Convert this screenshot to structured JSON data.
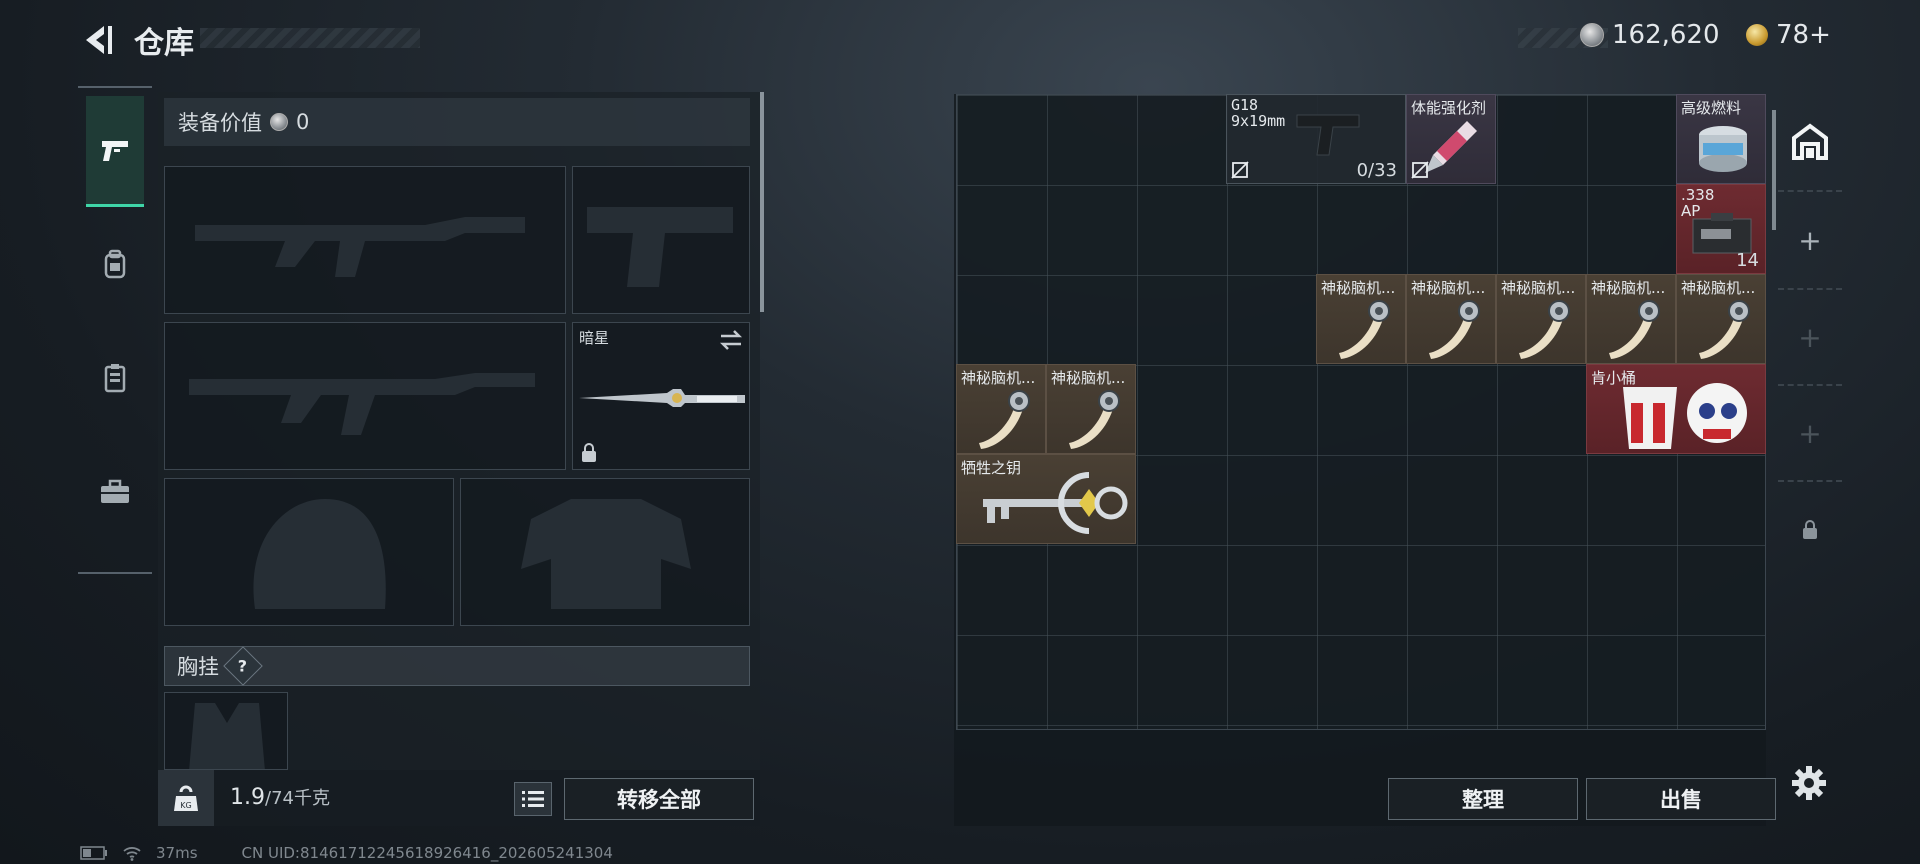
{
  "header": {
    "title": "仓库",
    "silver_amount": "162,620",
    "gold_amount": "78+"
  },
  "loadout": {
    "equip_value_label": "装备价值",
    "equip_value": "0",
    "melee_name": "暗星",
    "chest_label": "胸挂",
    "chest_help": "?"
  },
  "footer": {
    "weight_current": "1.9",
    "weight_max": "/74千克",
    "transfer_all": "转移全部",
    "sort": "整理",
    "sell": "出售",
    "ping": "37ms",
    "uid": "CN UID:814617122456189264​16_202605241304"
  },
  "inventory": {
    "g18_name": "G18",
    "g18_caliber": "9x19mm",
    "g18_ammo": "0/33",
    "stamina_name": "体能强化剂",
    "fuel_name": "高级燃料",
    "ammo338_name": ".338",
    "ammo338_type": "AP",
    "ammo338_count": "14",
    "brain_name": "神秘脑机...",
    "kfc_name": "肯小桶",
    "key_name": "牺牲之钥"
  },
  "colors": {
    "active_tab": "#3fd6a8",
    "brown_item": "#4a4034",
    "red_item": "#6e2b31",
    "purple_item": "#3a3644"
  }
}
